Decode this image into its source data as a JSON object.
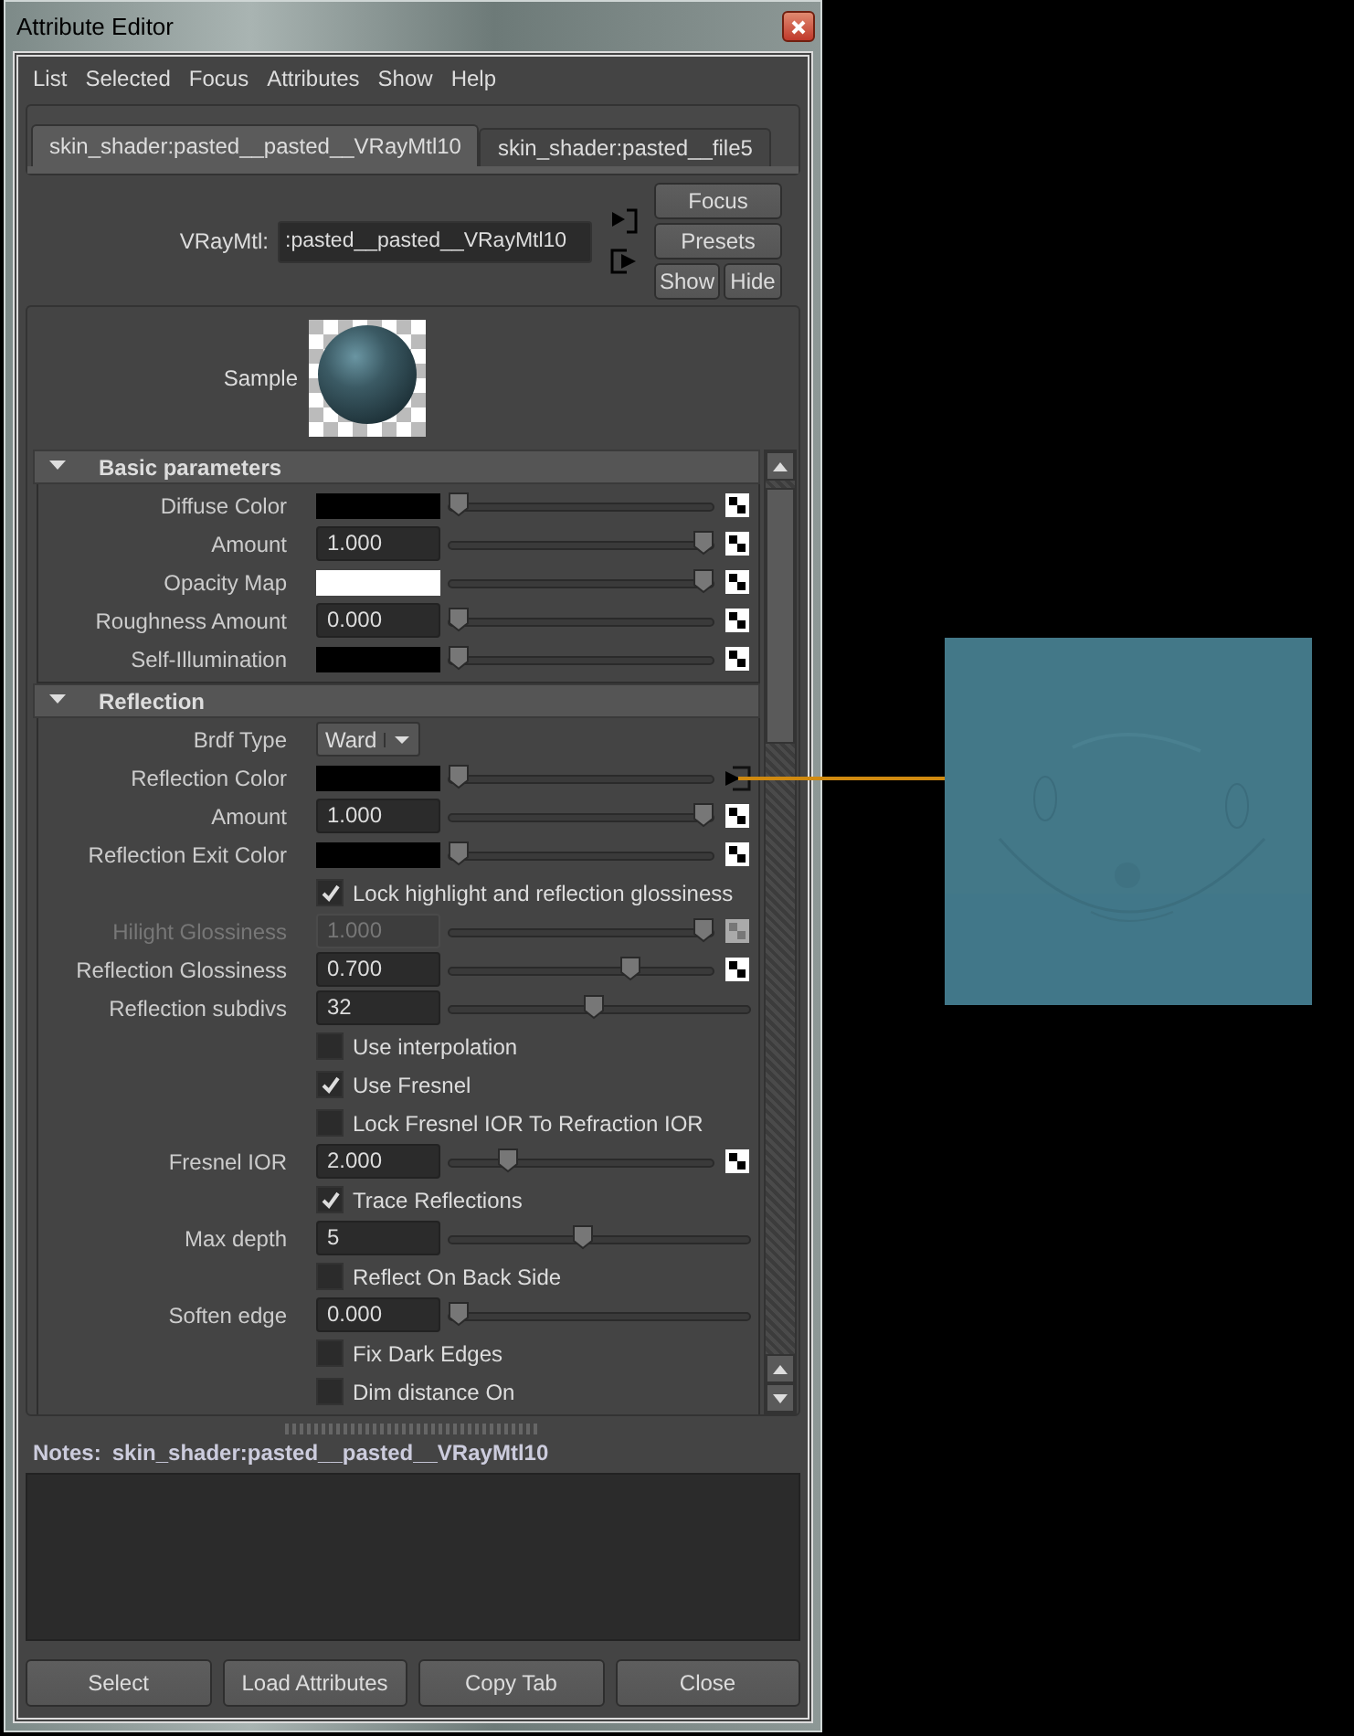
{
  "window": {
    "title": "Attribute Editor"
  },
  "menu": [
    "List",
    "Selected",
    "Focus",
    "Attributes",
    "Show",
    "Help"
  ],
  "tabs": [
    {
      "label": "skin_shader:pasted__pasted__VRayMtl10",
      "selected": true
    },
    {
      "label": "skin_shader:pasted__file5",
      "selected": false
    }
  ],
  "node": {
    "label": "VRayMtl:",
    "value": ":pasted__pasted__VRayMtl10"
  },
  "node_buttons": [
    "Focus",
    "Presets",
    "Show",
    "Hide"
  ],
  "sample": {
    "label": "Sample"
  },
  "sections": [
    {
      "title": "Basic parameters",
      "expanded": true,
      "rows": [
        {
          "kind": "color",
          "label": "Diffuse Color",
          "color": "#000000",
          "level": 0,
          "map_connected": false
        },
        {
          "kind": "number",
          "label": "Amount",
          "value": "1.000",
          "level": 1,
          "map_connected": false,
          "disabled": false
        },
        {
          "kind": "color",
          "label": "Opacity Map",
          "color": "#ffffff",
          "level": 1,
          "map_connected": false
        },
        {
          "kind": "number",
          "label": "Roughness Amount",
          "value": "0.000",
          "level": 0,
          "map_connected": false,
          "disabled": false
        },
        {
          "kind": "color",
          "label": "Self-Illumination",
          "color": "#000000",
          "level": 0,
          "map_connected": false
        }
      ]
    },
    {
      "title": "Reflection",
      "expanded": true,
      "rows": [
        {
          "kind": "dropdown",
          "label": "Brdf Type",
          "value": "Ward"
        },
        {
          "kind": "color",
          "label": "Reflection Color",
          "color": "#000000",
          "level": 0,
          "map_connected": true
        },
        {
          "kind": "number",
          "label": "Amount",
          "value": "1.000",
          "level": 1,
          "map_connected": false,
          "disabled": false
        },
        {
          "kind": "color",
          "label": "Reflection Exit Color",
          "color": "#000000",
          "level": 0,
          "map_connected": false
        },
        {
          "kind": "checkbox",
          "label": "Lock highlight and reflection glossiness",
          "checked": true
        },
        {
          "kind": "number",
          "label": "Hilight Glossiness",
          "value": "1.000",
          "level": 1,
          "map_connected": false,
          "disabled": true
        },
        {
          "kind": "number",
          "label": "Reflection Glossiness",
          "value": "0.700",
          "level": 0.7,
          "map_connected": false,
          "disabled": false
        },
        {
          "kind": "number",
          "label": "Reflection subdivs",
          "value": "32",
          "level": 0.48,
          "disabled": false
        },
        {
          "kind": "checkbox",
          "label": "Use interpolation",
          "checked": false
        },
        {
          "kind": "checkbox",
          "label": "Use Fresnel",
          "checked": true
        },
        {
          "kind": "checkbox",
          "label": "Lock Fresnel IOR To Refraction IOR",
          "checked": false
        },
        {
          "kind": "number",
          "label": "Fresnel IOR",
          "value": "2.000",
          "level": 0.2,
          "map_connected": false,
          "disabled": false
        },
        {
          "kind": "checkbox",
          "label": "Trace Reflections",
          "checked": true
        },
        {
          "kind": "number",
          "label": "Max depth",
          "value": "5",
          "level": 0.44,
          "disabled": false
        },
        {
          "kind": "checkbox",
          "label": "Reflect On Back Side",
          "checked": false
        },
        {
          "kind": "number",
          "label": "Soften edge",
          "value": "0.000",
          "level": 0,
          "disabled": false
        },
        {
          "kind": "checkbox",
          "label": "Fix Dark Edges",
          "checked": false
        },
        {
          "kind": "checkbox",
          "label": "Dim distance On",
          "checked": false
        }
      ]
    }
  ],
  "notes": {
    "label": "Notes:",
    "node": "skin_shader:pasted__pasted__VRayMtl10"
  },
  "buttons": [
    "Select",
    "Load Attributes",
    "Copy Tab",
    "Close"
  ],
  "texture": {
    "kind": "picture"
  }
}
